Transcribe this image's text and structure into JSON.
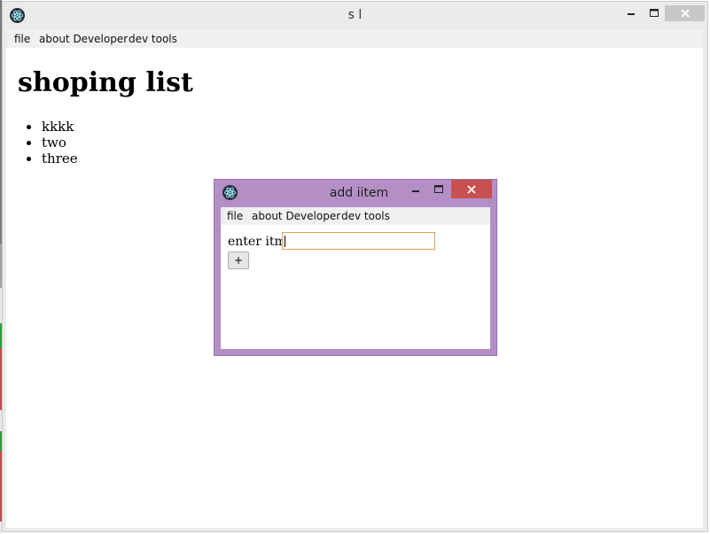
{
  "main_window": {
    "title": "s l",
    "menu": [
      "file",
      "about Developer",
      "dev tools"
    ],
    "heading": "shoping list",
    "items": [
      "kkkk",
      "two",
      "three"
    ]
  },
  "dialog": {
    "title": "add iitem",
    "menu": [
      "file",
      "about Developer",
      "dev tools"
    ],
    "field_label": "enter itm",
    "field_value": "",
    "add_button_label": "+"
  },
  "colors": {
    "dialog_frame": "#b48fc5",
    "close_button_active": "#c75050",
    "input_focus_border": "#e3a24a"
  },
  "icons": {
    "app": "electron-icon",
    "minimize": "minimize-icon",
    "maximize": "maximize-icon",
    "close": "close-icon"
  }
}
